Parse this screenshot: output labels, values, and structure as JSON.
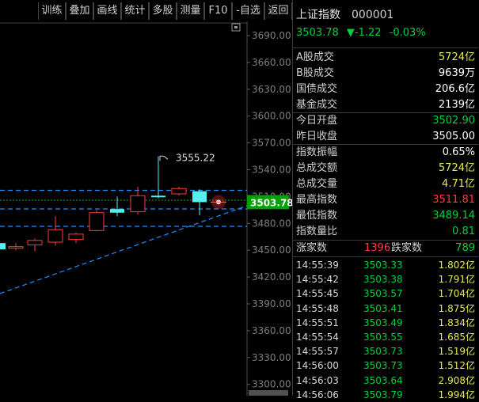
{
  "toolbar": {
    "buttons": [
      "训练",
      "叠加",
      "画线",
      "统计",
      "多股",
      "测量",
      "F10",
      "-自选",
      "返回"
    ]
  },
  "chart": {
    "price_ticks": [
      "3690.00",
      "3660.00",
      "3630.00",
      "3600.00",
      "3570.00",
      "3540.00",
      "3510.00",
      "3480.00",
      "3450.00",
      "3420.00",
      "3390.00",
      "3360.00",
      "3330.00",
      "3300.00"
    ],
    "bottom_tick_partial": "3300.00",
    "high_marker": "3555.22",
    "current_price_tag": "3503.78",
    "colors": {
      "up": "#ff3c3c",
      "down": "#55f0f0",
      "trendline": "#1e90ff",
      "tag_bg": "#00a000"
    },
    "icons": {
      "settings": "square-icon"
    }
  },
  "quote": {
    "name": "上证指数",
    "code": "000001",
    "price": "3503.78",
    "arrow": "▼",
    "change": "-1.22",
    "change_pct": "-0.03%"
  },
  "stats": [
    {
      "label": "A股成交",
      "value": "5724亿",
      "color": "yellow"
    },
    {
      "label": "B股成交",
      "value": "9639万",
      "color": "white"
    },
    {
      "label": "国债成交",
      "value": "206.6亿",
      "color": "white"
    },
    {
      "label": "基金成交",
      "value": "2139亿",
      "color": "white"
    },
    {
      "label": "今日开盘",
      "value": "3502.90",
      "color": "green"
    },
    {
      "label": "昨日收盘",
      "value": "3505.00",
      "color": "white"
    },
    {
      "label": "指数振幅",
      "value": "0.65%",
      "color": "white"
    },
    {
      "label": "总成交额",
      "value": "5724亿",
      "color": "yellow"
    },
    {
      "label": "总成交量",
      "value": "4.71亿",
      "color": "yellow"
    },
    {
      "label": "最高指数",
      "value": "3511.81",
      "color": "red"
    },
    {
      "label": "最低指数",
      "value": "3489.14",
      "color": "green"
    },
    {
      "label": "指数量比",
      "value": "0.81",
      "color": "green"
    }
  ],
  "breadth": {
    "up_label": "涨家数",
    "up_value": "1396",
    "down_label": "跌家数",
    "down_value": "789"
  },
  "ticks": [
    {
      "time": "14:55:39",
      "price": "3503.33",
      "vol": "1.802亿"
    },
    {
      "time": "14:55:42",
      "price": "3503.38",
      "vol": "1.791亿"
    },
    {
      "time": "14:55:45",
      "price": "3503.57",
      "vol": "1.704亿"
    },
    {
      "time": "14:55:48",
      "price": "3503.41",
      "vol": "1.875亿"
    },
    {
      "time": "14:55:51",
      "price": "3503.49",
      "vol": "1.834亿"
    },
    {
      "time": "14:55:54",
      "price": "3503.55",
      "vol": "1.685亿"
    },
    {
      "time": "14:55:57",
      "price": "3503.73",
      "vol": "1.519亿"
    },
    {
      "time": "14:56:00",
      "price": "3503.73",
      "vol": "1.512亿"
    },
    {
      "time": "14:56:03",
      "price": "3503.64",
      "vol": "2.908亿"
    },
    {
      "time": "14:56:06",
      "price": "3503.79",
      "vol": "1.994亿"
    }
  ]
}
